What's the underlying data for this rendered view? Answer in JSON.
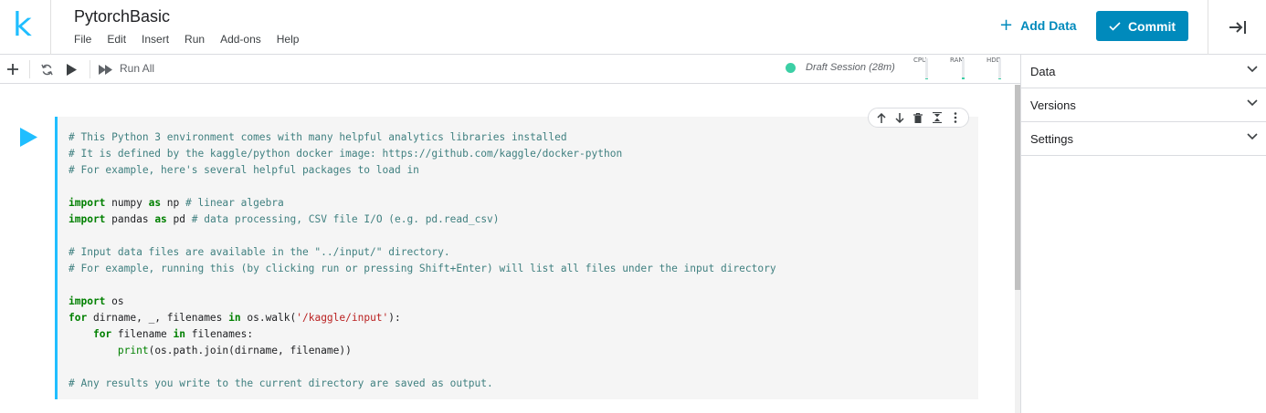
{
  "app": {
    "logo_letter": "k",
    "notebook_title": "PytorchBasic",
    "brand_color": "#20beff",
    "accent_color": "#008abc"
  },
  "menu": [
    "File",
    "Edit",
    "Insert",
    "Run",
    "Add-ons",
    "Help"
  ],
  "header_actions": {
    "add_data_label": "Add Data",
    "commit_label": "Commit"
  },
  "toolbar": {
    "icons": [
      "plus-icon",
      "refresh-icon",
      "play-icon",
      "fast-forward-icon"
    ],
    "run_all_label": "Run All",
    "session_label": "Draft Session (28m)",
    "session_status_color": "#3ccfa5",
    "meters": [
      {
        "label": "CPU",
        "fill": 0.05
      },
      {
        "label": "RAM",
        "fill": 0.08
      },
      {
        "label": "HDD",
        "fill": 0.06
      }
    ]
  },
  "cell": {
    "tools": [
      "arrow-up-icon",
      "arrow-down-icon",
      "trash-icon",
      "collapse-icon",
      "more-vert-icon"
    ],
    "code_lines": [
      "# This Python 3 environment comes with many helpful analytics libraries installed",
      "# It is defined by the kaggle/python docker image: https://github.com/kaggle/docker-python",
      "# For example, here's several helpful packages to load in",
      "",
      "import numpy as np # linear algebra",
      "import pandas as pd # data processing, CSV file I/O (e.g. pd.read_csv)",
      "",
      "# Input data files are available in the \"../input/\" directory.",
      "# For example, running this (by clicking run or pressing Shift+Enter) will list all files under the input directory",
      "",
      "import os",
      "for dirname, _, filenames in os.walk('/kaggle/input'):",
      "    for filename in filenames:",
      "        print(os.path.join(dirname, filename))",
      "",
      "# Any results you write to the current directory are saved as output."
    ]
  },
  "panel": {
    "sections": [
      "Data",
      "Versions",
      "Settings"
    ]
  }
}
